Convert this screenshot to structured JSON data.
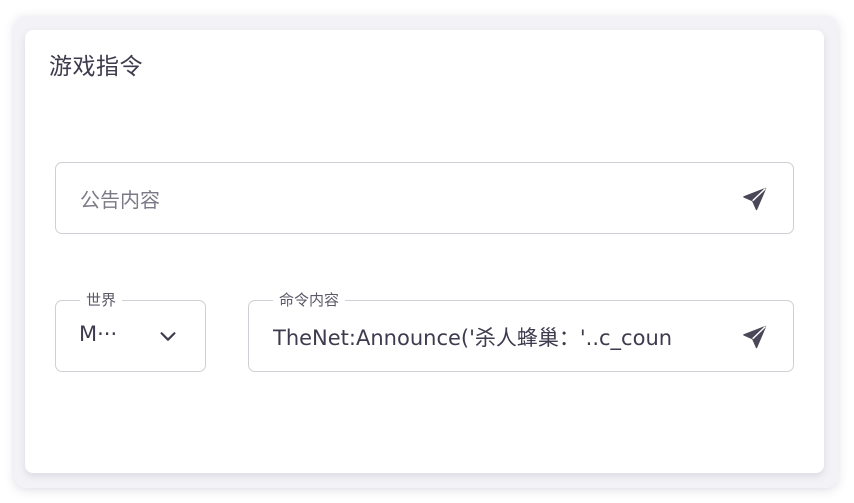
{
  "panel": {
    "title": "游戏指令"
  },
  "announce": {
    "placeholder": "公告内容",
    "send_icon": "send-icon"
  },
  "world": {
    "label": "世界",
    "selected": "M···",
    "icon": "chevron-down-icon"
  },
  "command": {
    "label": "命令内容",
    "value": "TheNet:Announce('杀人蜂巢：'..c_coun",
    "send_icon": "send-icon"
  },
  "colors": {
    "text": "#3d3b4d",
    "border": "#cfcfd6",
    "icon": "#4a4858"
  }
}
